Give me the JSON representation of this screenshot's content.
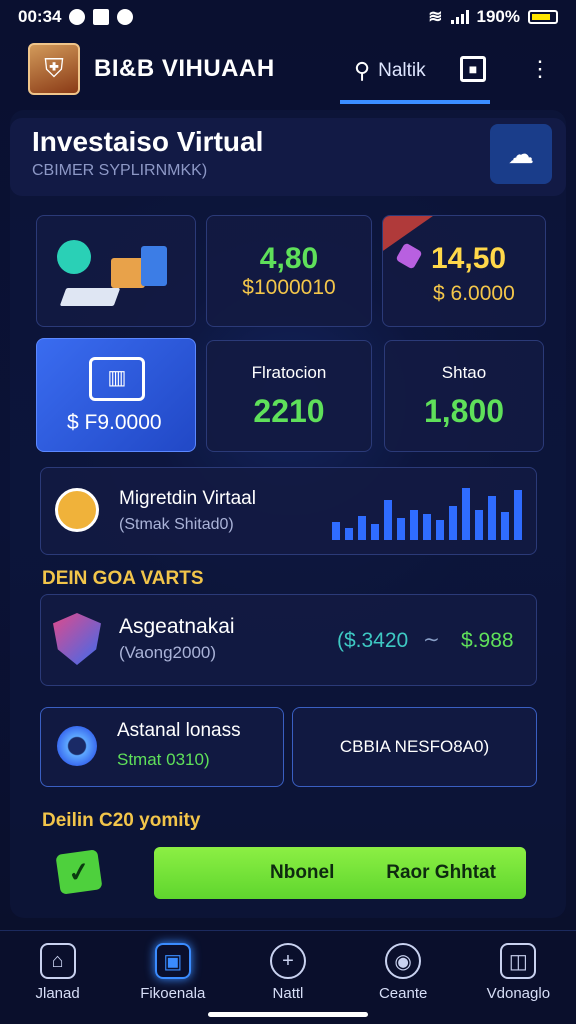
{
  "status_bar": {
    "time": "00:34",
    "battery": "190%"
  },
  "header": {
    "app_title": "BI&B VIHUAAH",
    "search_text": "Naltik"
  },
  "hero": {
    "title": "Investaiso Virtual",
    "subtitle": "CBIMER SYPLIRNMKK)"
  },
  "cards": {
    "c1": {
      "value": "4,80",
      "sub": "$1000010"
    },
    "c2": {
      "value": "14,50",
      "sub": "$ 6.0000"
    },
    "c3": {
      "label": "$ F9.0000"
    },
    "c4": {
      "title": "Flratocion",
      "value": "2210"
    },
    "c5": {
      "title": "Shtao",
      "value": "1,800"
    }
  },
  "promo": {
    "title": "Migretdin Virtaal",
    "subtitle": "(Stmak Shitad0)"
  },
  "section1": "DEIN GOA VARTS",
  "asset": {
    "title": "Asgeatnakai",
    "subtitle": "(Vaong2000)",
    "from": "($.3420",
    "to": "$.988"
  },
  "small_cards": {
    "left": {
      "title": "Astanal lonass",
      "subtitle": "Stmat 0310)"
    },
    "right": {
      "label": "CBBIA NESFO8A0)"
    }
  },
  "section2": "Deilin C20 yomity",
  "cta": {
    "left": "Nbonel",
    "right": "Raor Ghhtat"
  },
  "nav": [
    {
      "label": "Jlanad",
      "icon": "home-icon"
    },
    {
      "label": "Fikoenala",
      "icon": "portfolio-icon"
    },
    {
      "label": "Nattl",
      "icon": "add-icon"
    },
    {
      "label": "Ceante",
      "icon": "target-icon"
    },
    {
      "label": "Vdonaglo",
      "icon": "wallet-icon"
    }
  ],
  "colors": {
    "accent": "#3a8cff",
    "green": "#5fe05a",
    "yellow": "#ffd84a",
    "cta": "#6fe23a"
  }
}
